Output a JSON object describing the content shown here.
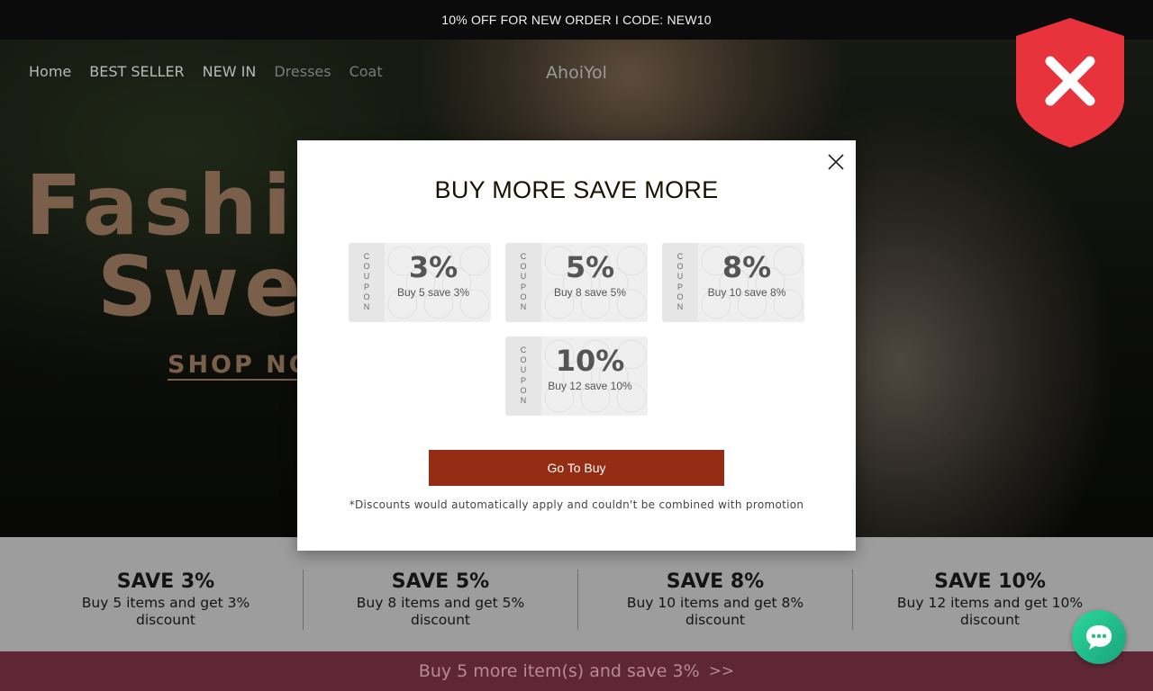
{
  "announcement": "10% OFF FOR NEW ORDER I CODE: NEW10",
  "nav": {
    "items": [
      "Home",
      "BEST SELLER",
      "NEW IN",
      "Dresses",
      "Coat"
    ],
    "logo": "AhoiYol"
  },
  "hero": {
    "title_line1": "Fashio",
    "title_line2": "Swea",
    "cta": "SHOP NOW"
  },
  "modal": {
    "title": "BUY MORE SAVE MORE",
    "coupon_label": "COUPON",
    "coupons": [
      {
        "percent": "3%",
        "desc": "Buy 5 save 3%"
      },
      {
        "percent": "5%",
        "desc": "Buy 8 save 5%"
      },
      {
        "percent": "8%",
        "desc": "Buy 10 save 8%"
      },
      {
        "percent": "10%",
        "desc": "Buy 12 save 10%"
      }
    ],
    "button": "Go To Buy",
    "disclaimer": "*Discounts would automatically apply and couldn't be combined with promotion"
  },
  "save_strip": [
    {
      "title": "SAVE 3%",
      "desc": "Buy 5 items and get 3% discount"
    },
    {
      "title": "SAVE 5%",
      "desc": "Buy 8 items and get 5% discount"
    },
    {
      "title": "SAVE 8%",
      "desc": "Buy 10 items and get 8% discount"
    },
    {
      "title": "SAVE 10%",
      "desc": "Buy 12 items and get 10% discount"
    }
  ],
  "bottom_bar": {
    "text": "Buy 5 more item(s) and save 3%",
    "arrows": ">>"
  },
  "icons": {
    "shield": "shield-x-icon",
    "close": "close-icon",
    "chat": "chat-bubble-icon"
  },
  "colors": {
    "button": "#952d14",
    "shield": "#e8323c",
    "bottom_bar": "#5f2736",
    "chat": "#1fbf86"
  }
}
